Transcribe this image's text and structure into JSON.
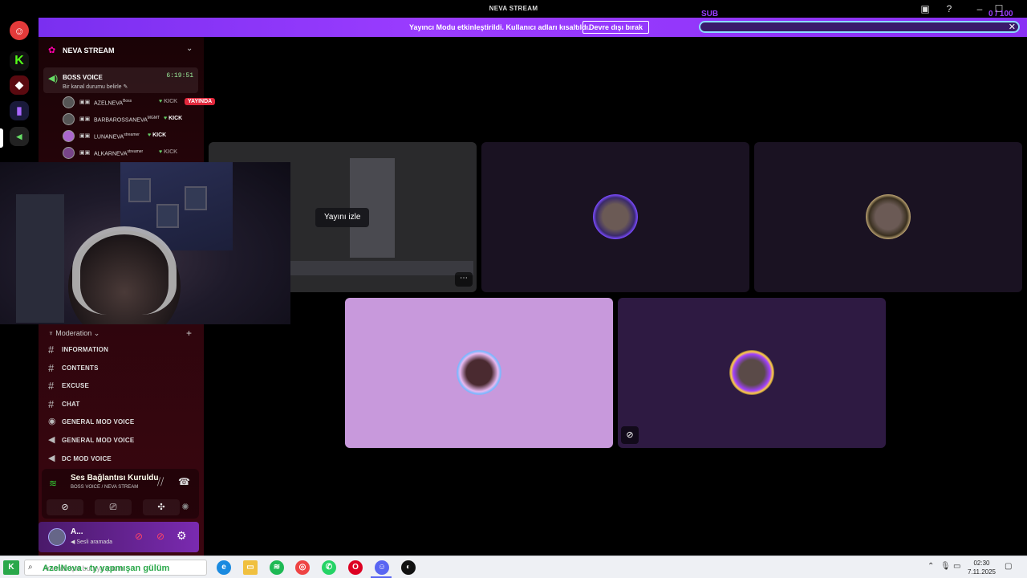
{
  "window": {
    "title": "NEVA STREAM"
  },
  "overlay": {
    "sub_label": "SUB",
    "sub_count": "0 / 100"
  },
  "banner": {
    "message": "Yayıncı Modu etkinleştirildi. Kullanıcı adları kısaltıldı.",
    "button": "Devre dışı bırak"
  },
  "server": {
    "name": "NEVA STREAM"
  },
  "voice_channel": {
    "name": "BOSS VOICE",
    "status": "Bir kanal durumu belirle",
    "timer": "6:19:51"
  },
  "members": [
    {
      "name": "AZELNEVA",
      "tag": "Boss",
      "platform": "KICK",
      "live": "YAYINDA"
    },
    {
      "name": "BARBAROSSANEVA",
      "tag": "MGMT",
      "platform": "KICK"
    },
    {
      "name": "LUNANEVA",
      "tag": "streamer",
      "platform": "KICK"
    },
    {
      "name": "ALKARNEVA",
      "tag": "streamer",
      "platform": "KICK"
    }
  ],
  "category": {
    "name": "Moderation"
  },
  "channels": [
    {
      "name": "INFORMATION",
      "type": "text"
    },
    {
      "name": "CONTENTS",
      "type": "text"
    },
    {
      "name": "EXCUSE",
      "type": "text"
    },
    {
      "name": "CHAT",
      "type": "text"
    },
    {
      "name": "GENERAL MOD VOICE",
      "type": "stage"
    },
    {
      "name": "GENERAL MOD VOICE",
      "type": "voice"
    },
    {
      "name": "DC MOD VOICE",
      "type": "voice"
    }
  ],
  "voice_panel": {
    "status": "Ses Bağlantısı Kuruldu",
    "location": "BOSS VOICE / NEVA STREAM"
  },
  "user": {
    "name": "A...",
    "status": "Sesli aramada"
  },
  "stream": {
    "watch_label": "Yayını izle"
  },
  "taskbar": {
    "search_placeholder": "Aramak için buraya yazın",
    "search_overlay": "AzelNeva - ty yapmışan gülüm",
    "time": "02:30",
    "date": "7.11.2025"
  },
  "colors": {
    "accent": "#9b3cff",
    "live": "#e0283c",
    "kick": "#53fc18"
  }
}
